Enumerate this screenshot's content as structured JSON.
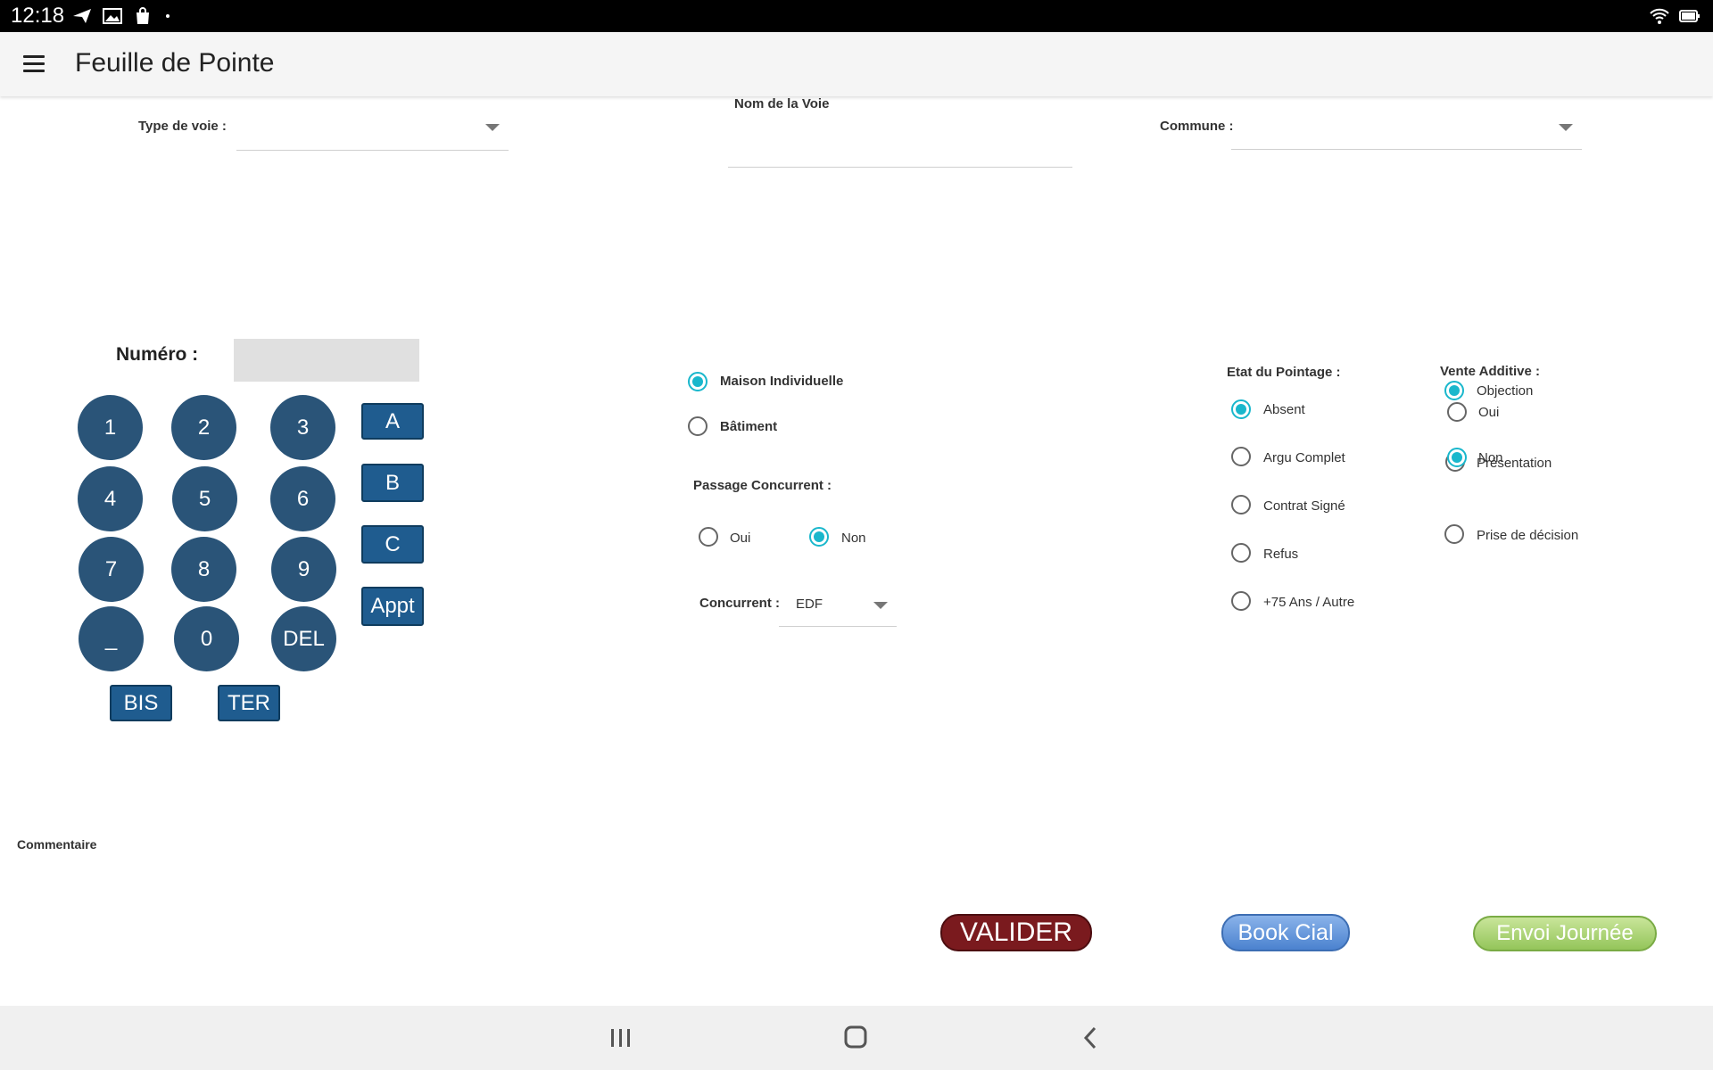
{
  "status": {
    "time": "12:18"
  },
  "app": {
    "title": "Feuille de Pointe"
  },
  "fields": {
    "type_voie_label": "Type de voie :",
    "nom_voie_label": "Nom de la Voie",
    "commune_label": "Commune :",
    "numero_label": "Numéro :",
    "commentaire_label": "Commentaire"
  },
  "keypad": {
    "digits": [
      "1",
      "2",
      "3",
      "4",
      "5",
      "6",
      "7",
      "8",
      "9",
      "_",
      "0",
      "DEL"
    ],
    "letters": [
      "A",
      "B",
      "C",
      "Appt"
    ],
    "suffix": [
      "BIS",
      "TER"
    ]
  },
  "housing": {
    "maison": "Maison Individuelle",
    "batiment": "Bâtiment",
    "selected": "maison"
  },
  "passage": {
    "label": "Passage Concurrent :",
    "oui": "Oui",
    "non": "Non",
    "selected": "non"
  },
  "concurrent": {
    "label": "Concurrent :",
    "value": "EDF"
  },
  "etat": {
    "label": "Etat du Pointage :",
    "options": [
      "Absent",
      "Argu Complet",
      "Contrat Signé",
      "Refus",
      "+75 Ans / Autre"
    ],
    "selected": "Absent"
  },
  "vente": {
    "label": "Vente Additive :",
    "objection": "Objection",
    "oui": "Oui",
    "non": "Non",
    "presentation": "Présentation",
    "prise_decision": "Prise de décision"
  },
  "buttons": {
    "valider": "VALIDER",
    "book_cial": "Book Cial",
    "envoi": "Envoi Journée"
  },
  "colors": {
    "accent": "#19b7cc",
    "keypad": "#2a5478",
    "valider": "#7a1a1e",
    "book": "#4b82cf",
    "envoi": "#94c55a"
  }
}
